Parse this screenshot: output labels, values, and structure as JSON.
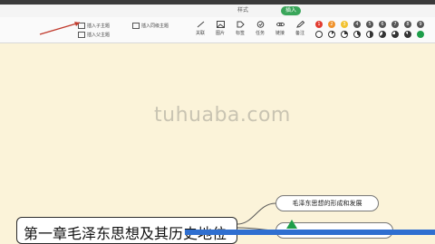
{
  "tabs": {
    "style": "样式",
    "insert": "插入"
  },
  "toolbar": {
    "insert_subtopic": "插入子主题",
    "insert_sibling": "插入同级主题",
    "insert_parent": "插入父主题",
    "tools": [
      "关联",
      "图片",
      "标签",
      "任务",
      "链接",
      "备注"
    ],
    "priority_numbers": [
      "1",
      "2",
      "3",
      "4",
      "5",
      "6",
      "7",
      "8",
      "9"
    ]
  },
  "canvas": {
    "watermark": "tuhuaba.com",
    "central_topic": "第一章毛泽东思想及其历史地位",
    "subtopics": [
      "毛泽东思想的形成和发展"
    ]
  },
  "colors": {
    "insert_tab": "#3aa65a",
    "arrow": "#c0392b",
    "canvas_bg": "#fbf3d9"
  },
  "icons": {
    "tools": [
      "link-icon",
      "image-icon",
      "tag-icon",
      "task-icon",
      "chain-icon",
      "note-icon"
    ]
  }
}
